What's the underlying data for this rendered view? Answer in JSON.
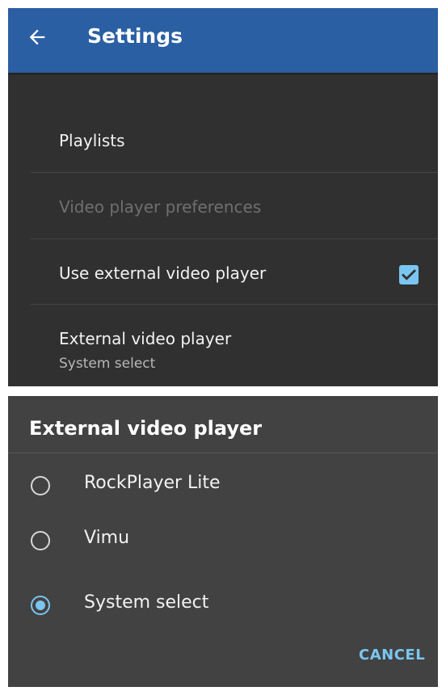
{
  "appbar": {
    "title": "Settings"
  },
  "settings": {
    "items": [
      {
        "label": "Playlists"
      },
      {
        "label": "Video player preferences"
      },
      {
        "label": "Use external video player",
        "checked": true
      },
      {
        "label": "External video player",
        "summary": "System select"
      }
    ]
  },
  "dialog": {
    "title": "External video player",
    "options": [
      {
        "label": "RockPlayer Lite",
        "selected": false
      },
      {
        "label": "Vimu",
        "selected": false
      },
      {
        "label": "System select",
        "selected": true
      }
    ],
    "cancel_label": "CANCEL"
  },
  "colors": {
    "appbar": "#2a5fa3",
    "background": "#303030",
    "dialog_background": "#424242",
    "accent": "#7ac6f0"
  },
  "icons": {
    "back": "arrow-left-icon",
    "checkbox": "checkbox-checked-icon"
  }
}
